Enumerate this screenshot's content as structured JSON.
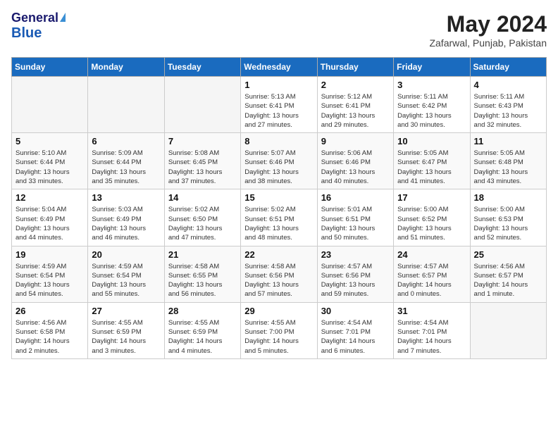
{
  "header": {
    "logo_general": "General",
    "logo_blue": "Blue",
    "month_title": "May 2024",
    "location": "Zafarwal, Punjab, Pakistan"
  },
  "days_of_week": [
    "Sunday",
    "Monday",
    "Tuesday",
    "Wednesday",
    "Thursday",
    "Friday",
    "Saturday"
  ],
  "weeks": [
    [
      {
        "day": "",
        "info": ""
      },
      {
        "day": "",
        "info": ""
      },
      {
        "day": "",
        "info": ""
      },
      {
        "day": "1",
        "info": "Sunrise: 5:13 AM\nSunset: 6:41 PM\nDaylight: 13 hours\nand 27 minutes."
      },
      {
        "day": "2",
        "info": "Sunrise: 5:12 AM\nSunset: 6:41 PM\nDaylight: 13 hours\nand 29 minutes."
      },
      {
        "day": "3",
        "info": "Sunrise: 5:11 AM\nSunset: 6:42 PM\nDaylight: 13 hours\nand 30 minutes."
      },
      {
        "day": "4",
        "info": "Sunrise: 5:11 AM\nSunset: 6:43 PM\nDaylight: 13 hours\nand 32 minutes."
      }
    ],
    [
      {
        "day": "5",
        "info": "Sunrise: 5:10 AM\nSunset: 6:44 PM\nDaylight: 13 hours\nand 33 minutes."
      },
      {
        "day": "6",
        "info": "Sunrise: 5:09 AM\nSunset: 6:44 PM\nDaylight: 13 hours\nand 35 minutes."
      },
      {
        "day": "7",
        "info": "Sunrise: 5:08 AM\nSunset: 6:45 PM\nDaylight: 13 hours\nand 37 minutes."
      },
      {
        "day": "8",
        "info": "Sunrise: 5:07 AM\nSunset: 6:46 PM\nDaylight: 13 hours\nand 38 minutes."
      },
      {
        "day": "9",
        "info": "Sunrise: 5:06 AM\nSunset: 6:46 PM\nDaylight: 13 hours\nand 40 minutes."
      },
      {
        "day": "10",
        "info": "Sunrise: 5:05 AM\nSunset: 6:47 PM\nDaylight: 13 hours\nand 41 minutes."
      },
      {
        "day": "11",
        "info": "Sunrise: 5:05 AM\nSunset: 6:48 PM\nDaylight: 13 hours\nand 43 minutes."
      }
    ],
    [
      {
        "day": "12",
        "info": "Sunrise: 5:04 AM\nSunset: 6:49 PM\nDaylight: 13 hours\nand 44 minutes."
      },
      {
        "day": "13",
        "info": "Sunrise: 5:03 AM\nSunset: 6:49 PM\nDaylight: 13 hours\nand 46 minutes."
      },
      {
        "day": "14",
        "info": "Sunrise: 5:02 AM\nSunset: 6:50 PM\nDaylight: 13 hours\nand 47 minutes."
      },
      {
        "day": "15",
        "info": "Sunrise: 5:02 AM\nSunset: 6:51 PM\nDaylight: 13 hours\nand 48 minutes."
      },
      {
        "day": "16",
        "info": "Sunrise: 5:01 AM\nSunset: 6:51 PM\nDaylight: 13 hours\nand 50 minutes."
      },
      {
        "day": "17",
        "info": "Sunrise: 5:00 AM\nSunset: 6:52 PM\nDaylight: 13 hours\nand 51 minutes."
      },
      {
        "day": "18",
        "info": "Sunrise: 5:00 AM\nSunset: 6:53 PM\nDaylight: 13 hours\nand 52 minutes."
      }
    ],
    [
      {
        "day": "19",
        "info": "Sunrise: 4:59 AM\nSunset: 6:54 PM\nDaylight: 13 hours\nand 54 minutes."
      },
      {
        "day": "20",
        "info": "Sunrise: 4:59 AM\nSunset: 6:54 PM\nDaylight: 13 hours\nand 55 minutes."
      },
      {
        "day": "21",
        "info": "Sunrise: 4:58 AM\nSunset: 6:55 PM\nDaylight: 13 hours\nand 56 minutes."
      },
      {
        "day": "22",
        "info": "Sunrise: 4:58 AM\nSunset: 6:56 PM\nDaylight: 13 hours\nand 57 minutes."
      },
      {
        "day": "23",
        "info": "Sunrise: 4:57 AM\nSunset: 6:56 PM\nDaylight: 13 hours\nand 59 minutes."
      },
      {
        "day": "24",
        "info": "Sunrise: 4:57 AM\nSunset: 6:57 PM\nDaylight: 14 hours\nand 0 minutes."
      },
      {
        "day": "25",
        "info": "Sunrise: 4:56 AM\nSunset: 6:57 PM\nDaylight: 14 hours\nand 1 minute."
      }
    ],
    [
      {
        "day": "26",
        "info": "Sunrise: 4:56 AM\nSunset: 6:58 PM\nDaylight: 14 hours\nand 2 minutes."
      },
      {
        "day": "27",
        "info": "Sunrise: 4:55 AM\nSunset: 6:59 PM\nDaylight: 14 hours\nand 3 minutes."
      },
      {
        "day": "28",
        "info": "Sunrise: 4:55 AM\nSunset: 6:59 PM\nDaylight: 14 hours\nand 4 minutes."
      },
      {
        "day": "29",
        "info": "Sunrise: 4:55 AM\nSunset: 7:00 PM\nDaylight: 14 hours\nand 5 minutes."
      },
      {
        "day": "30",
        "info": "Sunrise: 4:54 AM\nSunset: 7:01 PM\nDaylight: 14 hours\nand 6 minutes."
      },
      {
        "day": "31",
        "info": "Sunrise: 4:54 AM\nSunset: 7:01 PM\nDaylight: 14 hours\nand 7 minutes."
      },
      {
        "day": "",
        "info": ""
      }
    ]
  ]
}
